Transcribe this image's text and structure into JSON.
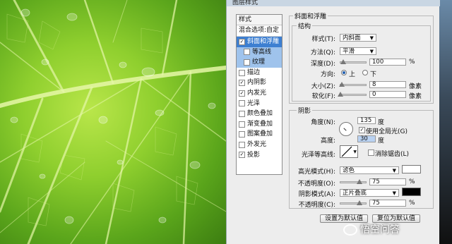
{
  "window": {
    "title": "图层样式"
  },
  "styles_panel": {
    "header": "样式",
    "blend_options": "混合选项:自定",
    "items": [
      {
        "label": "斜面和浮雕",
        "checked": true,
        "selected": true,
        "sub": false
      },
      {
        "label": "等高线",
        "checked": false,
        "selected": false,
        "sub": true
      },
      {
        "label": "纹理",
        "checked": false,
        "selected": false,
        "sub": true
      },
      {
        "label": "描边",
        "checked": false,
        "selected": false,
        "sub": false
      },
      {
        "label": "内阴影",
        "checked": true,
        "selected": false,
        "sub": false
      },
      {
        "label": "内发光",
        "checked": true,
        "selected": false,
        "sub": false
      },
      {
        "label": "光泽",
        "checked": false,
        "selected": false,
        "sub": false
      },
      {
        "label": "颜色叠加",
        "checked": false,
        "selected": false,
        "sub": false
      },
      {
        "label": "渐变叠加",
        "checked": false,
        "selected": false,
        "sub": false
      },
      {
        "label": "图案叠加",
        "checked": false,
        "selected": false,
        "sub": false
      },
      {
        "label": "外发光",
        "checked": false,
        "selected": false,
        "sub": false
      },
      {
        "label": "投影",
        "checked": true,
        "selected": false,
        "sub": false
      }
    ]
  },
  "bevel": {
    "section_title": "斜面和浮雕",
    "structure_title": "结构",
    "style_label": "样式(T):",
    "style_value": "内斜面",
    "technique_label": "方法(Q):",
    "technique_value": "平滑",
    "depth_label": "深度(D):",
    "depth_value": "100",
    "depth_level": 0.1,
    "depth_unit": "%",
    "direction_label": "方向:",
    "direction_up": "上",
    "direction_down": "下",
    "size_label": "大小(Z):",
    "size_value": "8",
    "size_level": 0.05,
    "size_unit": "像素",
    "soften_label": "软化(F):",
    "soften_value": "0",
    "soften_level": 0.0,
    "soften_unit": "像素"
  },
  "shading": {
    "title": "阴影",
    "angle_label": "角度(N):",
    "angle_value": "135",
    "angle_unit": "度",
    "global_light_label": "使用全局光(G)",
    "altitude_label": "高度:",
    "altitude_value": "30",
    "altitude_unit": "度",
    "gloss_contour_label": "光泽等高线:",
    "antialias_label": "消除锯齿(L)",
    "highlight_mode_label": "高光模式(H):",
    "highlight_mode_value": "滤色",
    "highlight_color": "#ffffff",
    "highlight_opacity_label": "不透明度(O):",
    "highlight_opacity_value": "75",
    "highlight_opacity_level": 0.75,
    "shadow_mode_label": "阴影模式(A):",
    "shadow_mode_value": "正片叠底",
    "shadow_color": "#000000",
    "shadow_opacity_label": "不透明度(C):",
    "shadow_opacity_value": "75",
    "shadow_opacity_level": 0.75,
    "percent": "%"
  },
  "buttons": {
    "make_default": "设置为默认值",
    "reset_default": "复位为默认值"
  },
  "watermark": {
    "text": "悟空问答"
  },
  "colors": {
    "selection": "#3d7fd1",
    "sub_item": "#9fc3ec",
    "leaf": "#8fcf2e"
  }
}
